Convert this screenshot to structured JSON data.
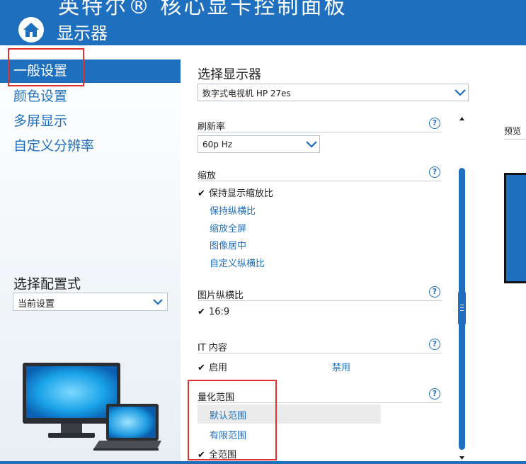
{
  "header": {
    "app_title": "英特尔® 核心显卡控制面板",
    "section_title": "显示器",
    "home_icon": "home-icon"
  },
  "sidebar": {
    "items": [
      {
        "label": "一般设置",
        "active": true
      },
      {
        "label": "颜色设置",
        "active": false
      },
      {
        "label": "多屏显示",
        "active": false
      },
      {
        "label": "自定义分辨率",
        "active": false
      }
    ],
    "profile_label": "选择配置式",
    "profile_value": "当前设置"
  },
  "main": {
    "select_display_label": "选择显示器",
    "display_value": "数字式电视机 HP 27es",
    "refresh": {
      "label": "刷新率",
      "value": "60p Hz"
    },
    "scaling": {
      "label": "缩放",
      "options": [
        {
          "label": "保持显示缩放比",
          "selected": true
        },
        {
          "label": "保持纵横比",
          "selected": false
        },
        {
          "label": "缩放全屏",
          "selected": false
        },
        {
          "label": "图像居中",
          "selected": false
        },
        {
          "label": "自定义纵横比",
          "selected": false
        }
      ]
    },
    "aspect_ratio": {
      "label": "图片纵横比",
      "value": "16:9"
    },
    "it_content": {
      "label": "IT 内容",
      "enable_label": "启用",
      "disable_label": "禁用"
    },
    "quantization": {
      "label": "量化范围",
      "options": [
        {
          "label": "默认范围",
          "selected": false
        },
        {
          "label": "有限范围",
          "selected": false
        },
        {
          "label": "全范围",
          "selected": true
        }
      ]
    },
    "help_glyph": "?",
    "check_glyph": "✔",
    "preview_label": "预览"
  },
  "colors": {
    "accent": "#1f6fbf",
    "highlight_box": "#e03030"
  }
}
